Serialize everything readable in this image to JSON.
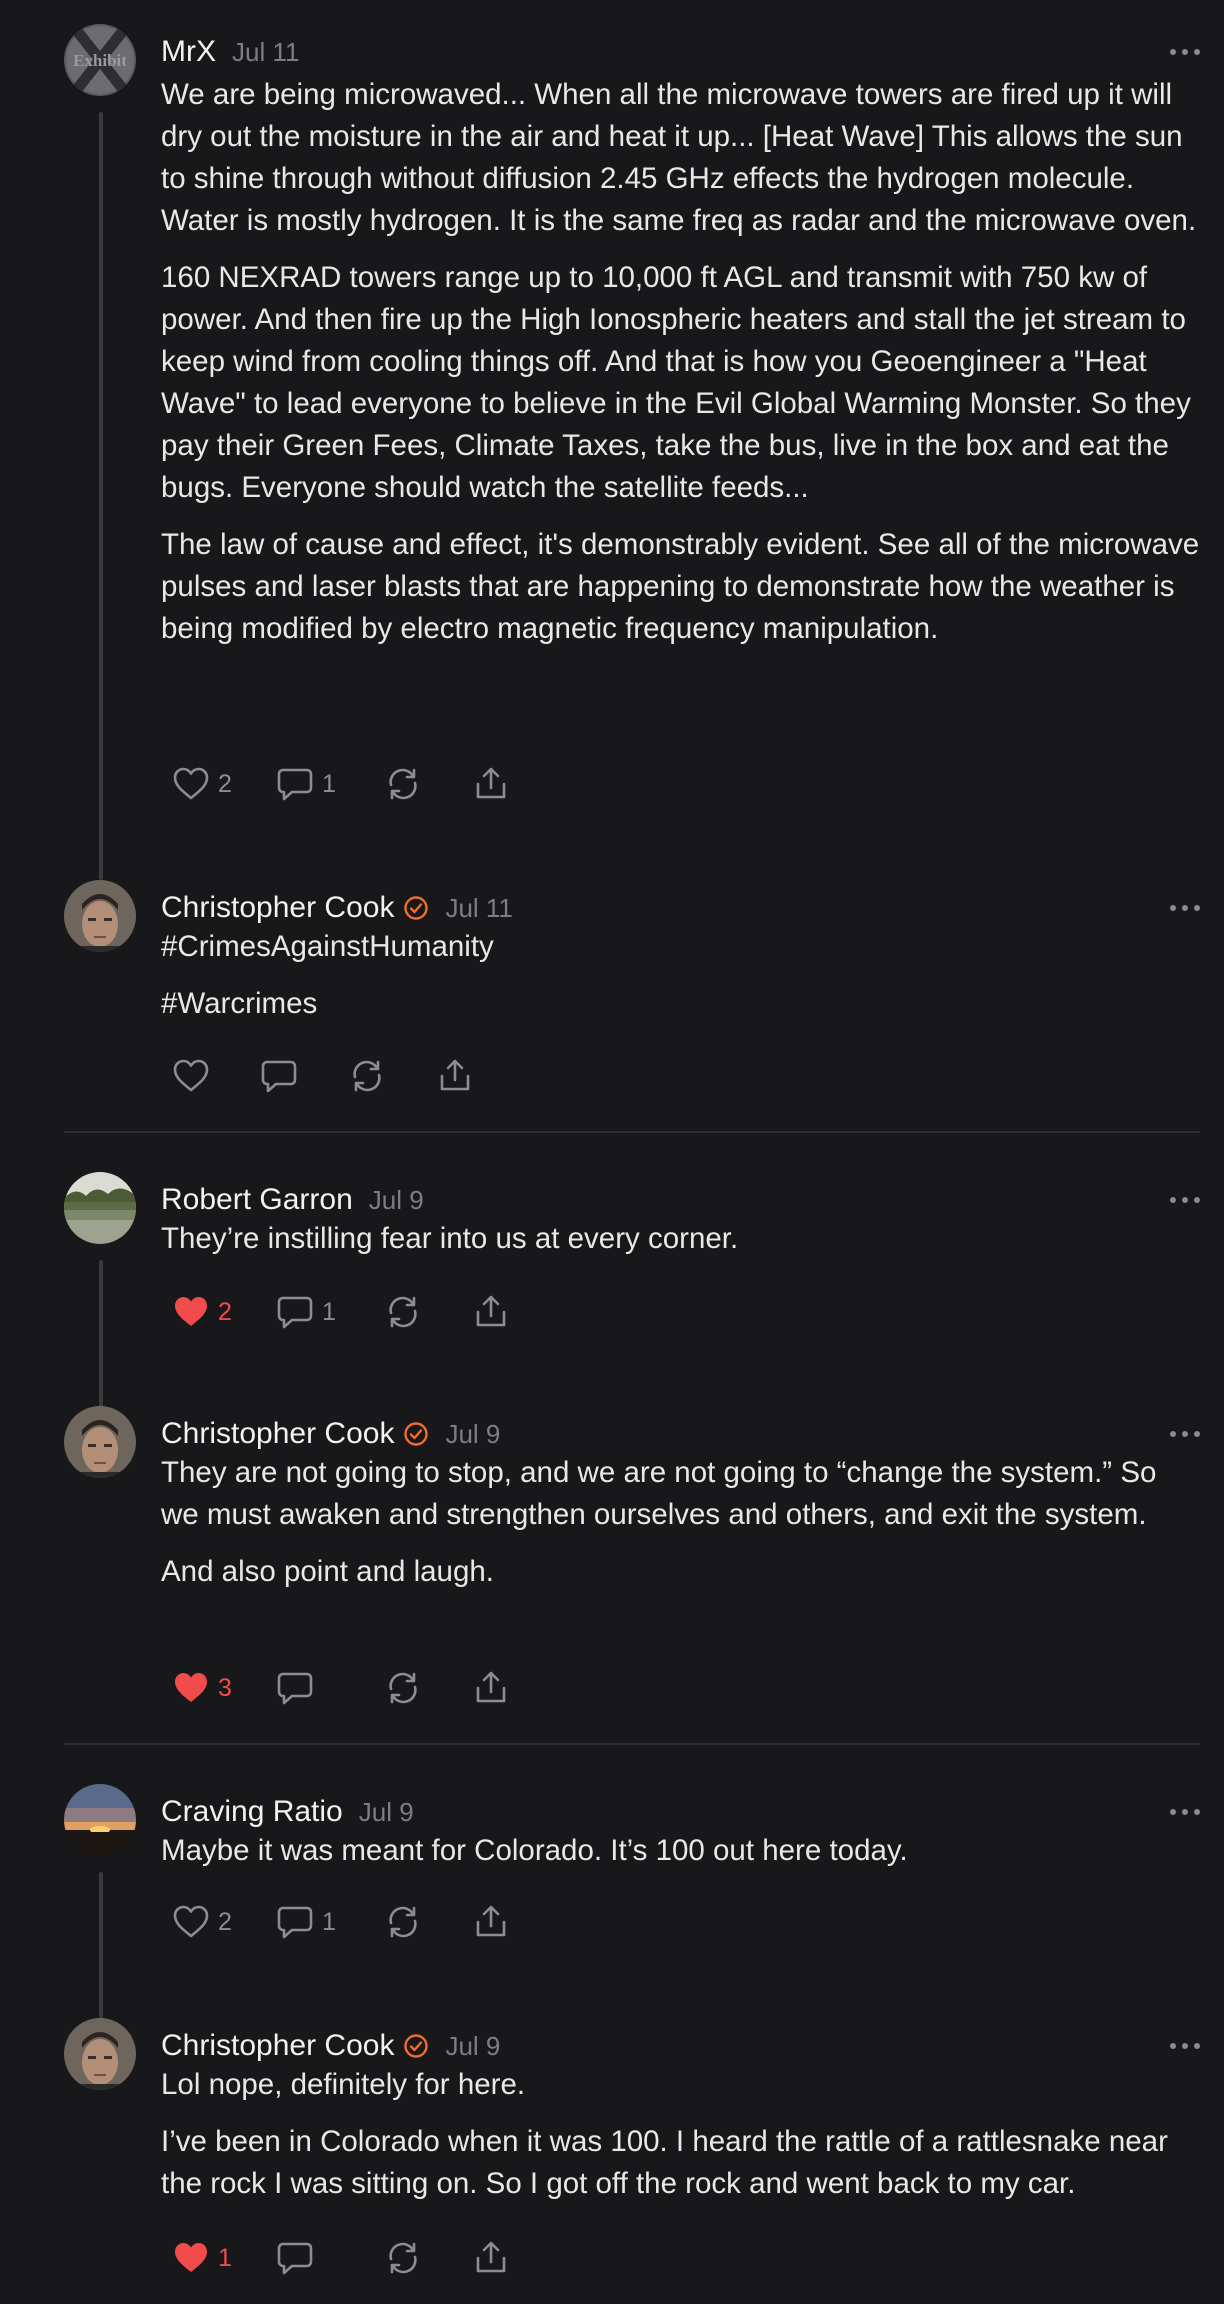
{
  "colors": {
    "background": "#18181a",
    "text": "#e8e8e8",
    "muted": "#7e7e82",
    "like_active": "#f24b4b",
    "verified": "#ef6d2f",
    "thread_line": "#3a3a3d"
  },
  "comments": [
    {
      "author": "MrX",
      "date": "Jul 11",
      "verified": false,
      "avatar_icon": "exhibit-x-avatar",
      "avatar_text": "Exhibit",
      "paragraphs": [
        "We are being microwaved... When all the microwave towers are fired up it will dry out the moisture in the air and heat it up... [Heat Wave] This allows the sun to shine through without diffusion 2.45 GHz effects the hydrogen molecule. Water is mostly hydrogen. It is the same freq as radar and the microwave oven.",
        "160 NEXRAD towers range up to 10,000 ft AGL and transmit with 750 kw of power. And then fire up the High Ionospheric heaters and stall the jet stream to keep wind from cooling things off. And that is how you Geoengineer a \"Heat Wave\" to lead everyone to believe in the Evil Global Warming Monster. So they pay their Green Fees, Climate Taxes, take the bus, live in the box and eat the bugs. Everyone should watch the satellite feeds...",
        "The law of cause and effect, it's demonstrably evident. See all of the microwave pulses and laser blasts that are happening to demonstrate how the weather is being modified by electro magnetic frequency manipulation."
      ],
      "likes": "2",
      "liked": false,
      "replies": "1"
    },
    {
      "author": "Christopher Cook",
      "date": "Jul 11",
      "verified": true,
      "avatar_icon": "christopher-cook-avatar",
      "paragraphs": [
        "#CrimesAgainstHumanity",
        "#Warcrimes"
      ],
      "likes": "",
      "liked": false,
      "replies": ""
    },
    {
      "author": "Robert Garron",
      "date": "Jul 9",
      "verified": false,
      "avatar_icon": "lake-landscape-avatar",
      "paragraphs": [
        "They’re instilling fear into us at every corner."
      ],
      "likes": "2",
      "liked": true,
      "replies": "1"
    },
    {
      "author": "Christopher Cook",
      "date": "Jul 9",
      "verified": true,
      "avatar_icon": "christopher-cook-avatar",
      "paragraphs": [
        "They are not going to stop, and we are not going to “change the system.” So we must awaken and strengthen ourselves and others, and exit the system.",
        "And also point and laugh."
      ],
      "likes": "3",
      "liked": true,
      "replies": ""
    },
    {
      "author": "Craving Ratio",
      "date": "Jul 9",
      "verified": false,
      "avatar_icon": "sunset-avatar",
      "paragraphs": [
        "Maybe it was meant for Colorado. It’s 100 out here today."
      ],
      "likes": "2",
      "liked": false,
      "replies": "1"
    },
    {
      "author": "Christopher Cook",
      "date": "Jul 9",
      "verified": true,
      "avatar_icon": "christopher-cook-avatar",
      "paragraphs": [
        "Lol nope, definitely for here.",
        "I’ve been in Colorado when it was 100. I heard the rattle of a rattlesnake near the rock I was sitting on. So I got off the rock and went back to my car."
      ],
      "likes": "1",
      "liked": true,
      "replies": ""
    }
  ]
}
